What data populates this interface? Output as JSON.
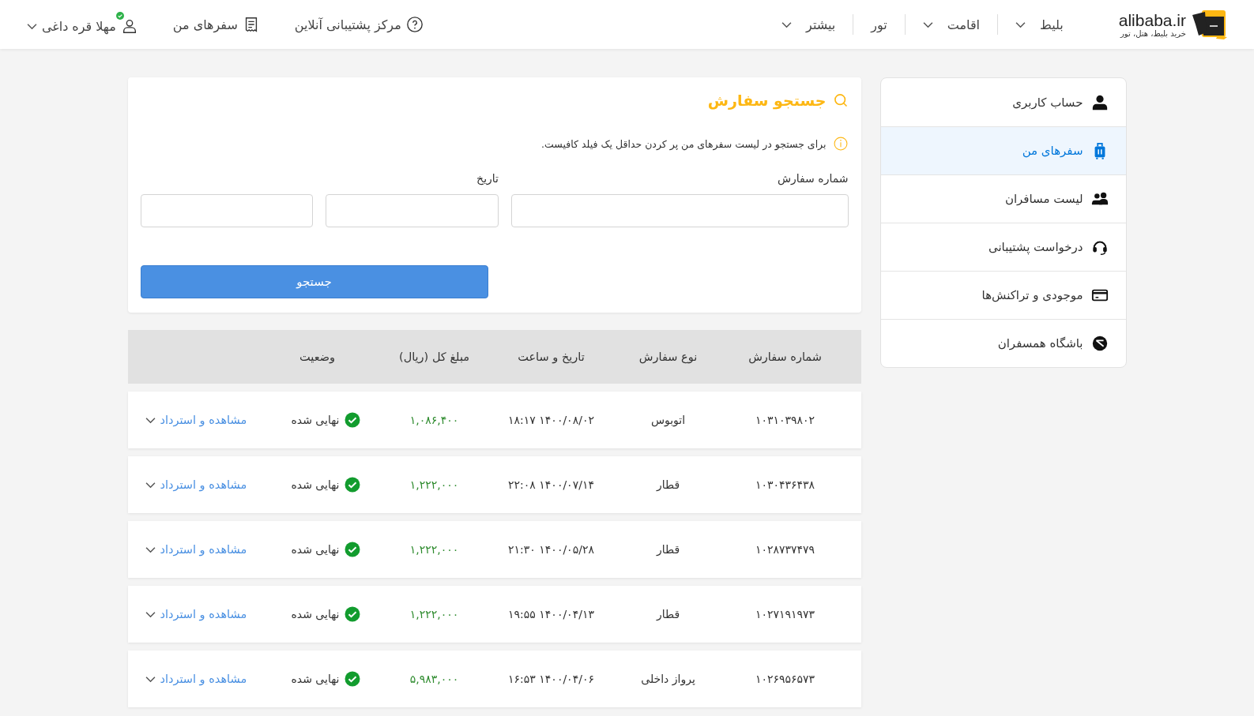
{
  "header": {
    "logo": {
      "name": "alibaba.ir",
      "tagline": "خرید بلیط، هتل، تور"
    },
    "nav": [
      {
        "label": "بلیط",
        "dropdown": true
      },
      {
        "label": "اقامت",
        "dropdown": true
      },
      {
        "label": "تور",
        "dropdown": false
      },
      {
        "label": "بیشتر",
        "dropdown": true
      }
    ],
    "support": "مرکز پشتیبانی آنلاین",
    "my_trips": "سفرهای من",
    "user": {
      "name": "مهلا قره داغی",
      "verified": true
    }
  },
  "sidebar": {
    "items": [
      {
        "label": "حساب کاربری",
        "selected": false
      },
      {
        "label": "سفرهای من",
        "selected": true
      },
      {
        "label": "لیست مسافران",
        "selected": false
      },
      {
        "label": "درخواست پشتیبانی",
        "selected": false
      },
      {
        "label": "موجودی و تراکنش‌ها",
        "selected": false
      },
      {
        "label": "باشگاه همسفران",
        "selected": false
      }
    ]
  },
  "search": {
    "title": "جستجو سفارش",
    "hint": "برای جستجو در لیست سفرهای من پر کردن حداقل یک فیلد کافیست.",
    "fields": [
      {
        "kind": "labeled",
        "label": "شماره سفارش"
      },
      {
        "kind": "labeled",
        "label": "تاریخ"
      },
      {
        "kind": "plain"
      }
    ],
    "button": "جستجو"
  },
  "table": {
    "columns": [
      "شماره سفارش",
      "نوع سفارش",
      "تاریخ و ساعت",
      "مبلغ کل (ریال)",
      "وضعیت"
    ],
    "rows": [
      {
        "order": "۱۰۳۱۰۳۹۸۰۲",
        "type": "اتوبوس",
        "datetime": "۱۴۰۰/۰۸/۰۲ ۱۸:۱۷",
        "amount": "۱,۰۸۶,۴۰۰",
        "status": "نهایی شده",
        "action": "مشاهده و استرداد"
      },
      {
        "order": "۱۰۳۰۴۳۶۴۳۸",
        "type": "قطار",
        "datetime": "۱۴۰۰/۰۷/۱۴ ۲۲:۰۸",
        "amount": "۱,۲۲۲,۰۰۰",
        "status": "نهایی شده",
        "action": "مشاهده و استرداد"
      },
      {
        "order": "۱۰۲۸۷۳۷۴۷۹",
        "type": "قطار",
        "datetime": "۱۴۰۰/۰۵/۲۸ ۲۱:۳۰",
        "amount": "۱,۲۲۲,۰۰۰",
        "status": "نهایی شده",
        "action": "مشاهده و استرداد"
      },
      {
        "order": "۱۰۲۷۱۹۱۹۷۳",
        "type": "قطار",
        "datetime": "۱۴۰۰/۰۴/۱۳ ۱۹:۵۵",
        "amount": "۱,۲۲۲,۰۰۰",
        "status": "نهایی شده",
        "action": "مشاهده و استرداد"
      },
      {
        "order": "۱۰۲۶۹۵۶۵۷۳",
        "type": "پرواز داخلی",
        "datetime": "۱۴۰۰/۰۴/۰۶ ۱۶:۵۳",
        "amount": "۵,۹۸۳,۰۰۰",
        "status": "نهایی شده",
        "action": "مشاهده و استرداد"
      }
    ]
  }
}
